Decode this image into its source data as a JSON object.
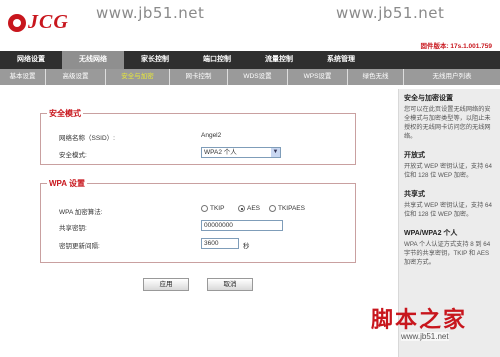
{
  "watermark": {
    "url_left": "www.jb51.net",
    "url_right": "www.jb51.net",
    "bottom_chars": "脚本之家",
    "bottom_url": "www.jb51.net"
  },
  "logo": {
    "text": "JCG"
  },
  "version": "固件版本: 17s.1.001.759",
  "main_nav": [
    {
      "label": "网络设置"
    },
    {
      "label": "无线网络"
    },
    {
      "label": "家长控制"
    },
    {
      "label": "端口控制"
    },
    {
      "label": "流量控制"
    },
    {
      "label": "系统管理"
    }
  ],
  "sub_nav": [
    {
      "label": "基本设置"
    },
    {
      "label": "高级设置"
    },
    {
      "label": "安全与加密"
    },
    {
      "label": "网卡控制"
    },
    {
      "label": "WDS设置"
    },
    {
      "label": "WPS设置"
    },
    {
      "label": "绿色无线"
    },
    {
      "label": "无线用户列表"
    }
  ],
  "security": {
    "title": "安全模式",
    "ssid_label": "网络名称（SSID）:",
    "ssid_value": "Angel2",
    "mode_label": "安全模式:",
    "mode_value": "WPA2 个人"
  },
  "wpa": {
    "title": "WPA 设置",
    "algo_label": "WPA 加密算法:",
    "algo_options": [
      "TKIP",
      "AES",
      "TKIPAES"
    ],
    "algo_selected": "AES",
    "key_label": "共享密钥:",
    "key_value": "00000000",
    "interval_label": "密钥更新间隔:",
    "interval_value": "3600",
    "interval_unit": "秒"
  },
  "buttons": {
    "apply": "应用",
    "cancel": "取消"
  },
  "help": [
    {
      "title": "安全与加密设置",
      "text": "您可以在此页设置无线网络的安全模式与加密类型等，以阻止未授权的无线网卡访问您的无线网络。"
    },
    {
      "title": "开放式",
      "text": "开放式 WEP 密钥认证，支持 64 位和 128 位 WEP 加密。"
    },
    {
      "title": "共享式",
      "text": "共享式 WEP 密钥认证，支持 64 位和 128 位 WEP 加密。"
    },
    {
      "title": "WPA/WPA2 个人",
      "text": "WPA 个人认证方式支持 8 到 64 字节的共享密钥，TKIP 和 AES 加密方式。"
    }
  ],
  "colors": {
    "brand_red": "#c8161d",
    "nav_dark": "#2f2f2f",
    "subnav_gray": "#9a9a9a"
  }
}
